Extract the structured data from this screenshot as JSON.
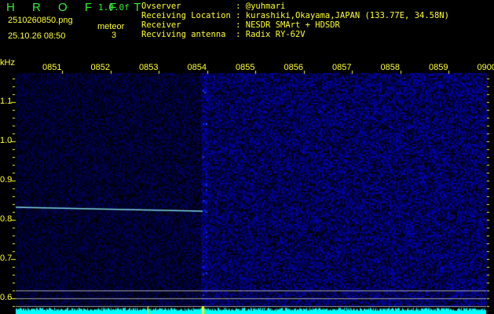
{
  "header": {
    "title": "H R O F F T",
    "version": "1.0.0f",
    "filename": "2510260850.png",
    "datetime": "25.10.26 08:50",
    "meteor_label": "meteor",
    "meteor_count": "3"
  },
  "info": [
    {
      "label": "Ovserver           ",
      "value": "@yuhmari"
    },
    {
      "label": "Receiving Location ",
      "value": "kurashiki,Okayama,JAPAN (133.77E, 34.58N)"
    },
    {
      "label": "Receiver           ",
      "value": "NESDR SMArt + HDSDR"
    },
    {
      "label": "Recviving antenna  ",
      "value": "Radix RY-62V"
    }
  ],
  "axis": {
    "unit": "kHz",
    "time_labels": [
      "0851",
      "0852",
      "0853",
      "0854",
      "0855",
      "0856",
      "0857",
      "0858",
      "0859",
      "0900"
    ],
    "freq_labels": [
      "1.1",
      "1.0",
      "0.9",
      "0.8",
      "0.7",
      "0.6"
    ]
  },
  "colors": {
    "text": "#ffff33",
    "title": "#33ee33",
    "noise": "#0000ff",
    "baseline": "#00ffff"
  }
}
